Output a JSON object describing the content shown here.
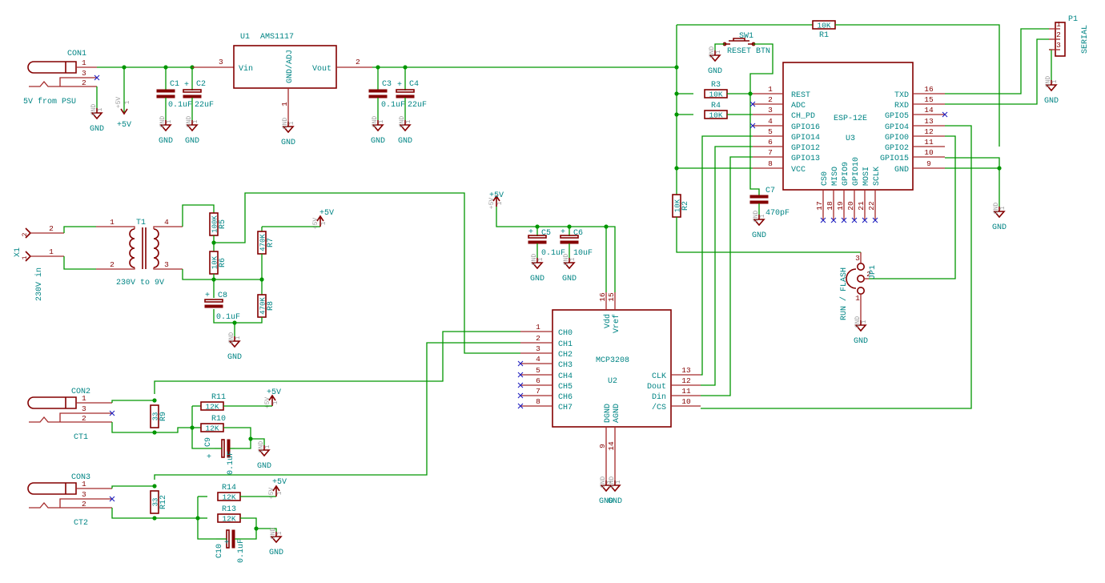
{
  "schematic": {
    "colors": {
      "wire": "#009600",
      "component": "#840000",
      "text": "#008484",
      "no_connect": "#2020c0",
      "junction": "#009600"
    }
  },
  "power": {
    "gnd": "GND",
    "vcc": "+5V",
    "pin": "1"
  },
  "components": {
    "CON1": {
      "ref": "CON1",
      "value": "5V from PSU",
      "pins": [
        "1",
        "3",
        "2"
      ]
    },
    "U1": {
      "ref": "U1",
      "value": "AMS1117",
      "pin_names": [
        "Vin",
        "GND/ADJ",
        "Vout"
      ],
      "pins": [
        "3",
        "1",
        "2"
      ]
    },
    "C1": {
      "ref": "C1",
      "value": "0.1uF"
    },
    "C2": {
      "ref": "C2",
      "value": "22uF",
      "polarity": "+"
    },
    "C3": {
      "ref": "C3",
      "value": "0.1uF"
    },
    "C4": {
      "ref": "C4",
      "value": "22uF",
      "polarity": "+"
    },
    "R1": {
      "ref": "R1",
      "value": "10K"
    },
    "SW1": {
      "ref": "SW1",
      "value": "RESET BTN"
    },
    "R3": {
      "ref": "R3",
      "value": "10K"
    },
    "R4": {
      "ref": "R4",
      "value": "10K"
    },
    "R2": {
      "ref": "R2",
      "value": "10K"
    },
    "C7": {
      "ref": "C7",
      "value": "470pF"
    },
    "U3": {
      "ref": "U3",
      "value": "ESP-12E",
      "left_pins": [
        {
          "num": "1",
          "name": "REST"
        },
        {
          "num": "2",
          "name": "ADC"
        },
        {
          "num": "3",
          "name": "CH_PD"
        },
        {
          "num": "4",
          "name": "GPIO16"
        },
        {
          "num": "5",
          "name": "GPIO14"
        },
        {
          "num": "6",
          "name": "GPIO12"
        },
        {
          "num": "7",
          "name": "GPIO13"
        },
        {
          "num": "8",
          "name": "VCC"
        }
      ],
      "right_pins": [
        {
          "num": "16",
          "name": "TXD"
        },
        {
          "num": "15",
          "name": "RXD"
        },
        {
          "num": "14",
          "name": "GPIO5"
        },
        {
          "num": "13",
          "name": "GPIO4"
        },
        {
          "num": "12",
          "name": "GPIO0"
        },
        {
          "num": "11",
          "name": "GPIO2"
        },
        {
          "num": "10",
          "name": "GPIO15"
        },
        {
          "num": "9",
          "name": "GND"
        }
      ],
      "bottom_pins": [
        {
          "num": "17",
          "name": "CS0"
        },
        {
          "num": "18",
          "name": "MISO"
        },
        {
          "num": "19",
          "name": "GPIO9"
        },
        {
          "num": "20",
          "name": "GPIO10"
        },
        {
          "num": "21",
          "name": "MOSI"
        },
        {
          "num": "22",
          "name": "SCLK"
        }
      ]
    },
    "P1": {
      "ref": "P1",
      "value": "SERIAL",
      "pins": [
        "1",
        "2",
        "3"
      ]
    },
    "JP1": {
      "ref": "JP1",
      "value": "RUN / FLASH",
      "pins": [
        "3",
        "2",
        "1"
      ]
    },
    "X1": {
      "ref": "X1",
      "value": "230V in",
      "pins": [
        "2",
        "1"
      ]
    },
    "T1": {
      "ref": "T1",
      "value": "230V to 9V",
      "pins": [
        "1",
        "2",
        "4",
        "3"
      ]
    },
    "R5": {
      "ref": "R5",
      "value": "100K"
    },
    "R6": {
      "ref": "R6",
      "value": "10K"
    },
    "R7": {
      "ref": "R7",
      "value": "470K"
    },
    "R8": {
      "ref": "R8",
      "value": "470K"
    },
    "C8": {
      "ref": "C8",
      "value": "0.1uF",
      "polarity": "+"
    },
    "C5": {
      "ref": "C5",
      "value": "0.1uF",
      "polarity": "+"
    },
    "C6": {
      "ref": "C6",
      "value": "10uF",
      "polarity": "+"
    },
    "U2": {
      "ref": "U2",
      "value": "MCP3208",
      "left_pins": [
        {
          "num": "1",
          "name": "CH0"
        },
        {
          "num": "2",
          "name": "CH1"
        },
        {
          "num": "3",
          "name": "CH2"
        },
        {
          "num": "4",
          "name": "CH3"
        },
        {
          "num": "5",
          "name": "CH4"
        },
        {
          "num": "6",
          "name": "CH5"
        },
        {
          "num": "7",
          "name": "CH6"
        },
        {
          "num": "8",
          "name": "CH7"
        }
      ],
      "right_pins": [
        {
          "num": "13",
          "name": "CLK"
        },
        {
          "num": "12",
          "name": "Dout"
        },
        {
          "num": "11",
          "name": "Din"
        },
        {
          "num": "10",
          "name": "/CS"
        }
      ],
      "top_pins": [
        {
          "num": "16",
          "name": "Vdd"
        },
        {
          "num": "15",
          "name": "Vref"
        }
      ],
      "bottom_pins": [
        {
          "num": "9",
          "name": "DGND"
        },
        {
          "num": "14",
          "name": "AGND"
        }
      ]
    },
    "CON2": {
      "ref": "CON2",
      "value": "CT1",
      "pins": [
        "1",
        "3",
        "2"
      ]
    },
    "R9": {
      "ref": "R9",
      "value": "33"
    },
    "R11": {
      "ref": "R11",
      "value": "12K"
    },
    "R10": {
      "ref": "R10",
      "value": "12K"
    },
    "C9": {
      "ref": "C9",
      "value": "0.1uF",
      "polarity": "+"
    },
    "CON3": {
      "ref": "CON3",
      "value": "CT2",
      "pins": [
        "1",
        "3",
        "2"
      ]
    },
    "R12": {
      "ref": "R12",
      "value": "33"
    },
    "R14": {
      "ref": "R14",
      "value": "12K"
    },
    "R13": {
      "ref": "R13",
      "value": "12K"
    },
    "C10": {
      "ref": "C10",
      "value": "0.1uF",
      "polarity": "+"
    }
  }
}
